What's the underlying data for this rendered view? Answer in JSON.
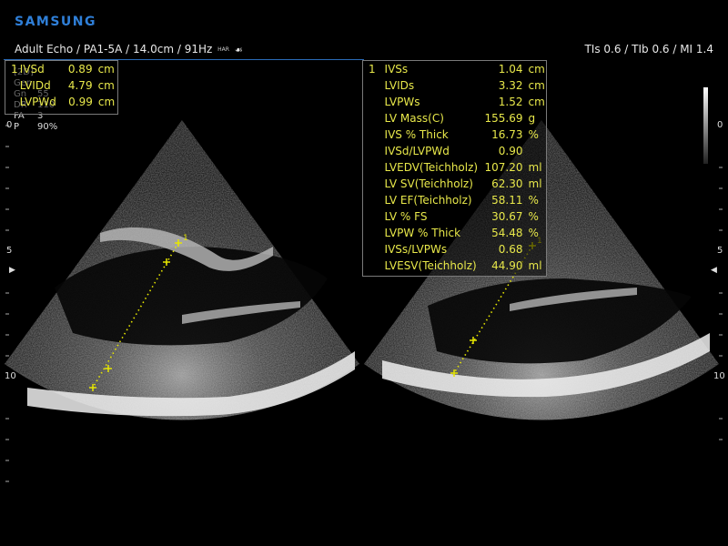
{
  "brand": "SAMSUNG",
  "header": {
    "mode": "Adult Echo / PA1-5A / 14.0cm / 91Hz",
    "har_badge": "HAR",
    "right_info": "TIs  0.6 / TIb  0.6 / MI    1.4"
  },
  "params": [
    {
      "key": "[2D]",
      "value": ""
    },
    {
      "key": "Gen",
      "value": ""
    },
    {
      "key": "Gn",
      "value": "55"
    },
    {
      "key": "DR",
      "value": "110"
    },
    {
      "key": "FA",
      "value": "3"
    },
    {
      "key": "P",
      "value": "90%"
    }
  ],
  "left_measurements": [
    {
      "index": "1",
      "name": "IVSd",
      "value": "0.89",
      "unit": "cm"
    },
    {
      "index": "",
      "name": "LVIDd",
      "value": "4.79",
      "unit": "cm"
    },
    {
      "index": "",
      "name": "LVPWd",
      "value": "0.99",
      "unit": "cm"
    }
  ],
  "right_measurements": [
    {
      "index": "1",
      "name": "IVSs",
      "value": "1.04",
      "unit": "cm"
    },
    {
      "index": "",
      "name": "LVIDs",
      "value": "3.32",
      "unit": "cm"
    },
    {
      "index": "",
      "name": "LVPWs",
      "value": "1.52",
      "unit": "cm"
    },
    {
      "index": "",
      "name": "LV Mass(C)",
      "value": "155.69",
      "unit": "g"
    },
    {
      "index": "",
      "name": "IVS % Thick",
      "value": "16.73",
      "unit": "%"
    },
    {
      "index": "",
      "name": "IVSd/LVPWd",
      "value": "0.90",
      "unit": ""
    },
    {
      "index": "",
      "name": "LVEDV(Teichholz)",
      "value": "107.20",
      "unit": "ml"
    },
    {
      "index": "",
      "name": "LV SV(Teichholz)",
      "value": "62.30",
      "unit": "ml"
    },
    {
      "index": "",
      "name": "LV EF(Teichholz)",
      "value": "58.11",
      "unit": "%"
    },
    {
      "index": "",
      "name": "LV % FS",
      "value": "30.67",
      "unit": "%"
    },
    {
      "index": "",
      "name": "LVPW % Thick",
      "value": "54.48",
      "unit": "%"
    },
    {
      "index": "",
      "name": "IVSs/LVPWs",
      "value": "0.68",
      "unit": ""
    },
    {
      "index": "",
      "name": "LVESV(Teichholz)",
      "value": "44.90",
      "unit": "ml"
    }
  ],
  "depth_scale": {
    "labels": [
      "0",
      "5",
      "10"
    ],
    "right_labels": [
      "0",
      "5",
      "10"
    ]
  },
  "caliper_labels": {
    "left": "1",
    "right": "1"
  },
  "colors": {
    "accent": "#2f7fd8",
    "measurement_text": "#e8e84a",
    "caliper": "#e6e600"
  }
}
